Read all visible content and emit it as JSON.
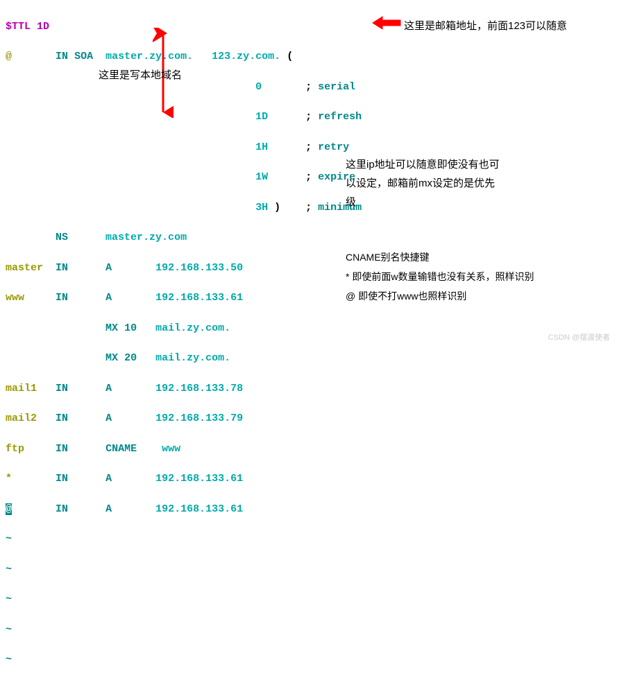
{
  "dns": {
    "ttl_directive": "$TTL",
    "ttl_value": "1D",
    "at": "@",
    "in": "IN",
    "soa": "SOA",
    "master_fqdn": "master.zy.com.",
    "rname": "123.zy.com.",
    "paren_open": "(",
    "paren_close": ")",
    "serial": "0",
    "refresh": "1D",
    "retry": "1H",
    "expire": "1W",
    "minimum": "3H",
    "semi": ";",
    "c_serial": "serial",
    "c_refresh": "refresh",
    "c_retry": "retry",
    "c_expire": "expire",
    "c_minimum": "minimum",
    "ns": "NS",
    "master_host": "master.zy.com",
    "row_master": {
      "name": "master",
      "type": "A",
      "ip": "192.168.133.50"
    },
    "row_www": {
      "name": "www",
      "type": "A",
      "ip": "192.168.133.61"
    },
    "mx1": {
      "type": "MX",
      "pri": "10",
      "host": "mail.zy.com."
    },
    "mx2": {
      "type": "MX",
      "pri": "20",
      "host": "mail.zy.com."
    },
    "row_mail1": {
      "name": "mail1",
      "type": "A",
      "ip": "192.168.133.78"
    },
    "row_mail2": {
      "name": "mail2",
      "type": "A",
      "ip": "192.168.133.79"
    },
    "row_ftp": {
      "name": "ftp",
      "type": "CNAME",
      "tgt": "www"
    },
    "row_star": {
      "name": "*",
      "type": "A",
      "ip": "192.168.133.61"
    },
    "row_at": {
      "name": "@",
      "type": "A",
      "ip": "192.168.133.61"
    },
    "tilde": "~"
  },
  "annotations": {
    "top": "这里是邮箱地址，前面123可以随意",
    "mid": "这里是写本地域名",
    "ip": {
      "l1": "这里ip地址可以随意即使没有也可",
      "l2": "以设定，邮箱前mx设定的是优先",
      "l3": "级"
    },
    "cname": {
      "l1": "CNAME别名快捷键",
      "l2": "* 即使前面w数量输错也没有关系，照样识别",
      "l3": "@ 即使不打www也照样识别"
    }
  },
  "watermark": "CSDN @摆渡使者"
}
